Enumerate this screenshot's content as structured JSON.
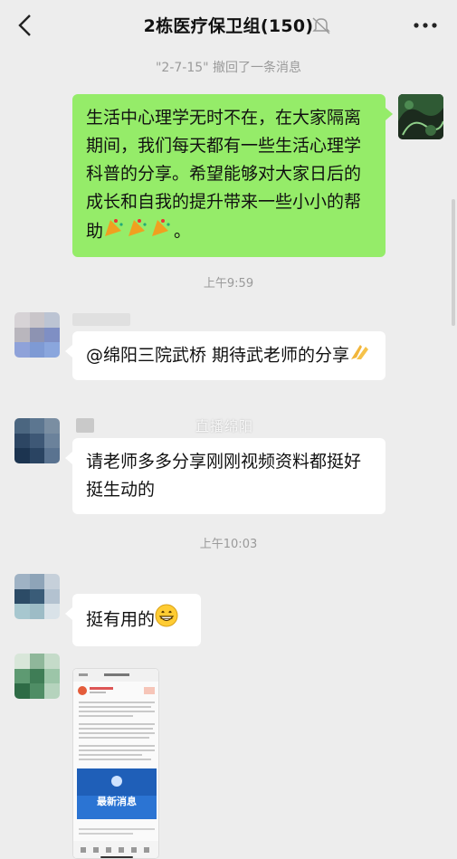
{
  "header": {
    "title": "2栋医疗保卫组(150)"
  },
  "system": {
    "recall_notice": "\"2-7-15\" 撤回了一条消息",
    "time1": "上午9:59",
    "time2": "上午10:03"
  },
  "messages": {
    "out1": "生活中心理学无时不在，在大家隔离期间，我们每天都有一些生活心理学科普的分享。希望能够对大家日后的成长和自我的提升带来一些小小的帮助",
    "out1_tail": "。",
    "in1": "@绵阳三院武桥  期待武老师的分享",
    "in2": "请老师多多分享刚刚视频资料都挺好挺生动的",
    "in3": "挺有用的"
  },
  "watermark": "直播绵阳",
  "shared_image": {
    "banner_text": "最新消息"
  },
  "colors": {
    "background": "#ededed",
    "bubble_out": "#95ec69",
    "bubble_in": "#ffffff",
    "system_text": "#9a9a9a"
  }
}
